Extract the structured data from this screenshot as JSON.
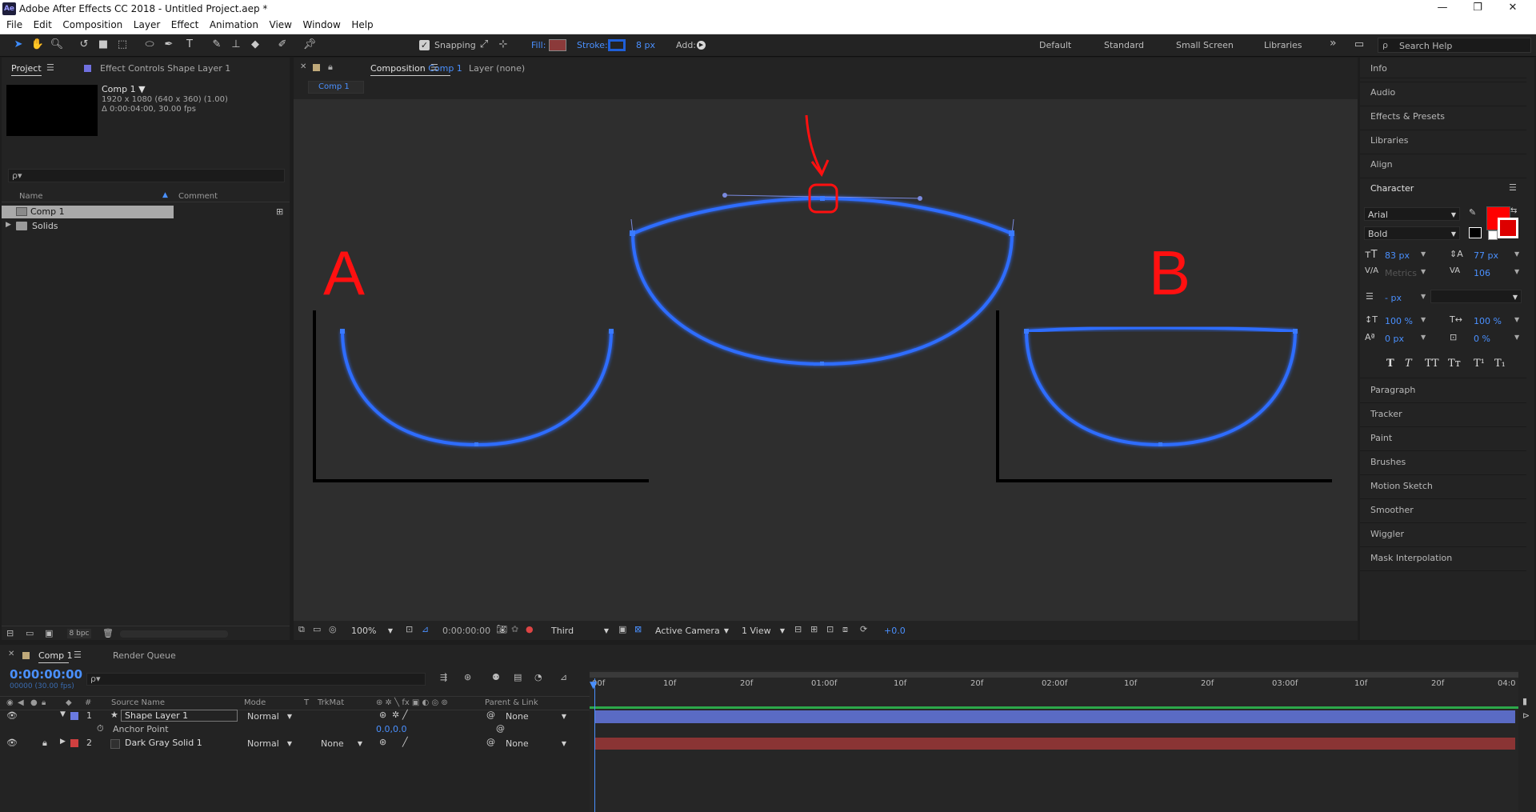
{
  "app": {
    "logo": "Ae",
    "title": "Adobe After Effects CC 2018 - Untitled Project.aep *"
  },
  "window_controls": {
    "minimize": "—",
    "maximize": "❐",
    "close": "✕"
  },
  "menu": [
    "File",
    "Edit",
    "Composition",
    "Layer",
    "Effect",
    "Animation",
    "View",
    "Window",
    "Help"
  ],
  "toolbar": {
    "snapping_label": "Snapping",
    "snapping_checked": true,
    "fill_label": "Fill:",
    "fill_color": "#8b3a3a",
    "stroke_label": "Stroke:",
    "stroke_color": "#1f5fd8",
    "stroke_width": "8 px",
    "add_label": "Add:",
    "workspaces": [
      "Default",
      "Standard",
      "Small Screen",
      "Libraries"
    ],
    "more": "»",
    "search_placeholder": "Search Help"
  },
  "project": {
    "tab_project": "Project",
    "tab_effect_controls": "Effect Controls Shape Layer 1",
    "comp_name": "Comp 1 ▼",
    "comp_info1": "1920 x 1080  (640 x 360) (1.00)",
    "comp_info2": "Δ 0:00:04:00, 30.00 fps",
    "search_placeholder": "ρ▾",
    "col_name": "Name",
    "col_comment": "Comment",
    "items": [
      {
        "name": "Comp 1",
        "type": "comp",
        "selected": true
      },
      {
        "name": "Solids",
        "type": "folder",
        "selected": false
      }
    ],
    "bpc": "8 bpc"
  },
  "composition": {
    "tab_label_prefix": "Composition",
    "tab_comp": "Comp 1",
    "tab_layer": "Layer  (none)",
    "breadcrumb": "Comp 1",
    "label_a": "A",
    "label_b": "B",
    "annotation_color": "#ff1010",
    "stroke_color": "#2f6dff",
    "footer": {
      "zoom": "100%",
      "timecode": "0:00:00:00",
      "resolution": "Third",
      "camera": "Active Camera",
      "views": "1 View",
      "exposure": "+0.0"
    }
  },
  "right_panels": {
    "items_top": [
      "Info",
      "Audio",
      "Effects & Presets",
      "Libraries",
      "Align"
    ],
    "character": {
      "title": "Character",
      "font": "Arial",
      "style": "Bold",
      "color": "#ff0000",
      "size": "83 px",
      "leading": "77 px",
      "kerning": "Metrics",
      "tracking": "106",
      "stroke_width": "- px",
      "vscale": "100 %",
      "hscale": "100 %",
      "baseline": "0 px",
      "tsume": "0 %",
      "format_buttons": [
        "T",
        "T",
        "TT",
        "Tт",
        "T¹",
        "T₁"
      ]
    },
    "items_bottom": [
      "Paragraph",
      "Tracker",
      "Paint",
      "Brushes",
      "Motion Sketch",
      "Smoother",
      "Wiggler",
      "Mask Interpolation"
    ]
  },
  "timeline": {
    "tab_comp": "Comp 1",
    "tab_render": "Render Queue",
    "timecode": "0:00:00:00",
    "timecode_sub": "00000 (30.00 fps)",
    "headers": {
      "num": "#",
      "source": "Source Name",
      "mode": "Mode",
      "t": "T",
      "trkmat": "TrkMat",
      "parent": "Parent & Link"
    },
    "layers": [
      {
        "num": "1",
        "name": "Shape Layer 1",
        "mode": "Normal",
        "trkmat": "",
        "parent": "None",
        "color": "#6a7ae0",
        "selected": true
      },
      {
        "num": "2",
        "name": "Dark Gray Solid 1",
        "mode": "Normal",
        "trkmat": "None",
        "parent": "None",
        "color": "#d04040",
        "selected": false
      }
    ],
    "property": {
      "name": "Anchor Point",
      "value": "0.0,0.0"
    },
    "ruler": [
      "00f",
      "10f",
      "20f",
      "01:00f",
      "10f",
      "20f",
      "02:00f",
      "10f",
      "20f",
      "03:00f",
      "10f",
      "20f",
      "04:0"
    ]
  }
}
